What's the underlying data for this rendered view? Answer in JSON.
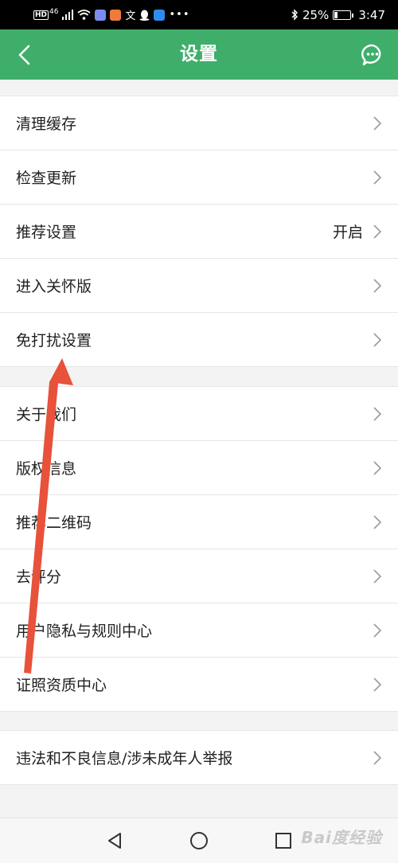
{
  "status_bar": {
    "network": "HD",
    "signal_label": "46",
    "battery_percent": "25%",
    "battery_level": 0.25,
    "time": "3:47",
    "icons": [
      "signal-icon",
      "wifi-icon",
      "music-app-icon",
      "fox-app-icon",
      "translate-icon",
      "qq-icon",
      "search-app-icon",
      "more-dots-icon",
      "bluetooth-icon",
      "battery-icon"
    ]
  },
  "header": {
    "title": "设置",
    "back_icon": "back-arrow-icon",
    "chat_icon": "chat-bubble-icon"
  },
  "settings": {
    "group1": [
      {
        "label": "清理缓存",
        "value": ""
      },
      {
        "label": "检查更新",
        "value": ""
      },
      {
        "label": "推荐设置",
        "value": "开启"
      },
      {
        "label": "进入关怀版",
        "value": ""
      },
      {
        "label": "免打扰设置",
        "value": ""
      }
    ],
    "group2": [
      {
        "label": "关于我们",
        "value": ""
      },
      {
        "label": "版权信息",
        "value": ""
      },
      {
        "label": "推荐二维码",
        "value": ""
      },
      {
        "label": "去评分",
        "value": ""
      },
      {
        "label": "用户隐私与规则中心",
        "value": ""
      },
      {
        "label": "证照资质中心",
        "value": ""
      }
    ],
    "group3": [
      {
        "label": "违法和不良信息/涉未成年人举报",
        "value": ""
      }
    ]
  },
  "system_nav": {
    "icons": [
      "back-triangle-icon",
      "home-circle-icon",
      "recents-square-icon"
    ]
  },
  "watermark": {
    "text": "Bai度经验"
  },
  "colors": {
    "header_bg": "#3fae6a",
    "arrow": "#e8513a",
    "page_bg": "#f3f3f3"
  }
}
